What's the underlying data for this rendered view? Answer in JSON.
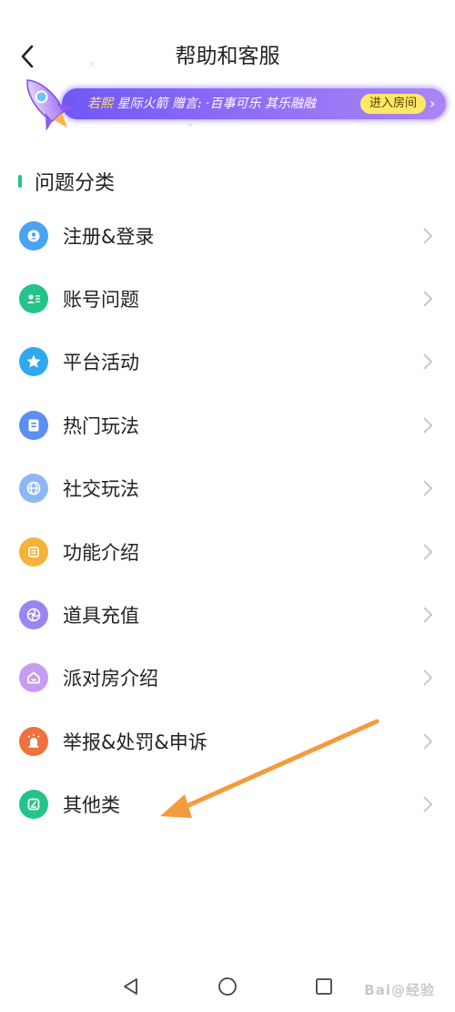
{
  "header": {
    "title": "帮助和客服"
  },
  "banner": {
    "name": "若熙",
    "message": " 星际火箭 赠言: ·百事可乐 其乐融融",
    "button_label": "进入房间",
    "colors": {
      "pill": "#7a5cf6",
      "button": "#ffe866"
    }
  },
  "section": {
    "title": "问题分类",
    "accent": "#23c38a"
  },
  "categories": [
    {
      "label": "注册&登录",
      "icon": "user-circle-icon",
      "color": "#4aa3f0"
    },
    {
      "label": "账号问题",
      "icon": "id-card-icon",
      "color": "#23c38a"
    },
    {
      "label": "平台活动",
      "icon": "star-icon",
      "color": "#2ea9f0"
    },
    {
      "label": "热门玩法",
      "icon": "document-icon",
      "color": "#5b8ff0"
    },
    {
      "label": "社交玩法",
      "icon": "globe-icon",
      "color": "#8eb8f5"
    },
    {
      "label": "功能介绍",
      "icon": "function-icon",
      "color": "#f6b33b"
    },
    {
      "label": "道具充值",
      "icon": "aperture-icon",
      "color": "#9a86f2"
    },
    {
      "label": "派对房介绍",
      "icon": "house-icon",
      "color": "#c79bf2"
    },
    {
      "label": "举报&处罚&申诉",
      "icon": "alarm-icon",
      "color": "#f0713e"
    },
    {
      "label": "其他类",
      "icon": "edit-icon",
      "color": "#23c38a"
    }
  ],
  "watermark": "Bai@经验"
}
